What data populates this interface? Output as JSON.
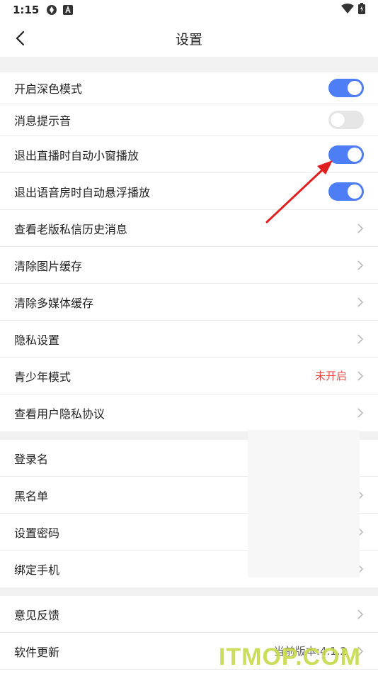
{
  "status_bar": {
    "time": "1:15"
  },
  "nav": {
    "title": "设置"
  },
  "section1": [
    {
      "label": "开启深色模式",
      "toggle": "on"
    },
    {
      "label": "消息提示音",
      "toggle": "off"
    },
    {
      "label": "退出直播时自动小窗播放",
      "toggle": "on"
    },
    {
      "label": "退出语音房时自动悬浮播放",
      "toggle": "on"
    },
    {
      "label": "查看老版私信历史消息"
    },
    {
      "label": "清除图片缓存"
    },
    {
      "label": "清除多媒体缓存"
    },
    {
      "label": "隐私设置"
    },
    {
      "label": "青少年模式",
      "value": "未开启"
    },
    {
      "label": "查看用户隐私协议"
    }
  ],
  "section2": [
    {
      "label": "登录名"
    },
    {
      "label": "黑名单"
    },
    {
      "label": "设置密码"
    },
    {
      "label": "绑定手机"
    }
  ],
  "section3": [
    {
      "label": "意见反馈"
    },
    {
      "label": "软件更新",
      "value": "当前版本:4.1.2"
    }
  ],
  "watermark": "ITMOP.COM",
  "colors": {
    "toggle_on": "#4d7ef6",
    "toggle_off": "#e6e6e6",
    "warning_red": "#f04848",
    "arrow_red": "#e02020"
  }
}
